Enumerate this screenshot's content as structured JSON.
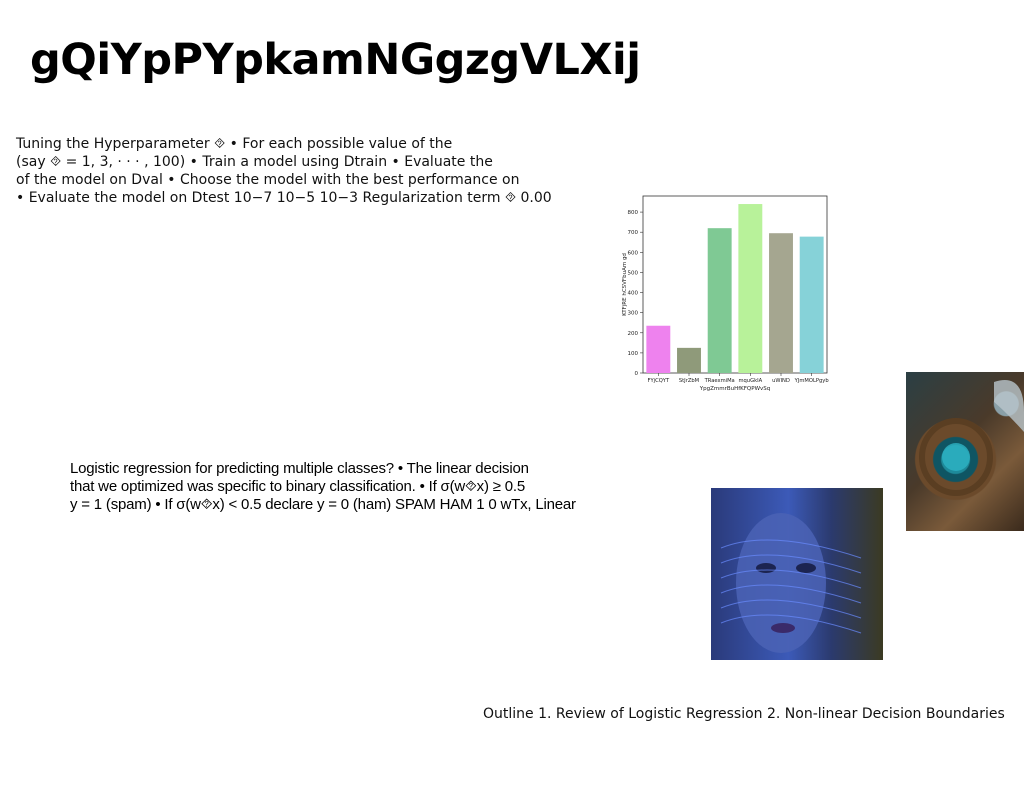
{
  "slide": {
    "title": "gQiYpPYpkamNGgzgVLXij",
    "paragraph1": [
      "Tuning the Hyperparameter ⯑ • For each possible value of the",
      "(say ⯑ = 1, 3, · · · , 100) • Train a model using Dtrain • Evaluate the",
      "of the model on Dval • Choose the model with the best performance on",
      "• Evaluate the model on Dtest 10−7 10−5 10−3 Regularization term ⯑ 0.00"
    ],
    "paragraph2": [
      "Logistic regression for predicting multiple classes? • The linear decision",
      "that we optimized was specific to binary classification. • If σ(w⯑x) ≥ 0.5",
      "y = 1 (spam) • If σ(w⯑x) < 0.5 declare y = 0 (ham) SPAM HAM 1 0 wTx, Linear"
    ],
    "outline": "Outline 1. Review of Logistic Regression 2. Non-linear Decision Boundaries",
    "images": {
      "tea": "tea-cup-photo",
      "face": "face-hologram-photo"
    }
  },
  "chart_data": {
    "type": "bar",
    "categories": [
      "FYjCQYT",
      "StJrZbM",
      "TRaexmiMa",
      "mquGkIA",
      "uWIND",
      "YJmMOLPgyb"
    ],
    "values": [
      235,
      125,
      720,
      840,
      695,
      678
    ],
    "colors": [
      "#ee82ee",
      "#8f9a7a",
      "#7fc994",
      "#b8f29a",
      "#a5a690",
      "#86d2d8"
    ],
    "xlabel": "YpgZmmrBuHfKFQPWvSq",
    "ylabel": "KTFjRE hCSVFbuAm gd",
    "ylim": [
      0,
      880
    ],
    "yticks": [
      0,
      100,
      200,
      300,
      400,
      500,
      600,
      700,
      800
    ],
    "grid": false
  }
}
